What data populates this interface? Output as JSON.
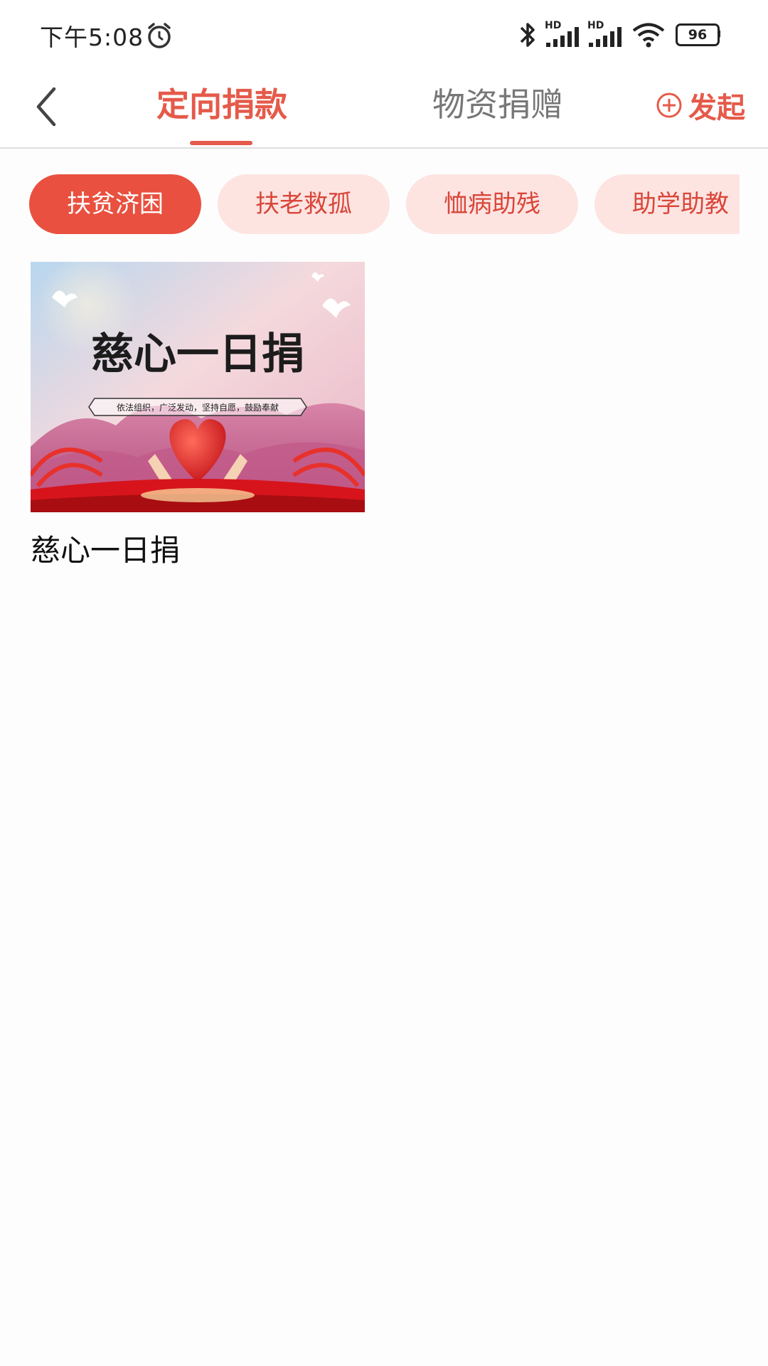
{
  "status_bar": {
    "time": "下午5:08",
    "battery": "96",
    "network_label_1": "HD",
    "network_label_2": "HD"
  },
  "nav": {
    "tabs": [
      {
        "label": "定向捐款",
        "active": true
      },
      {
        "label": "物资捐赠",
        "active": false
      }
    ],
    "launch_label": "发起",
    "accent_color": "#e55a4a"
  },
  "categories": [
    {
      "label": "扶贫济困",
      "active": true
    },
    {
      "label": "扶老救孤",
      "active": false
    },
    {
      "label": "恤病助残",
      "active": false
    },
    {
      "label": "助学助教",
      "active": false
    }
  ],
  "cards": [
    {
      "title": "慈心一日捐",
      "image_headline": "慈心一日捐",
      "image_slogan": "依法组织，广泛发动，坚持自愿，鼓励奉献"
    }
  ]
}
